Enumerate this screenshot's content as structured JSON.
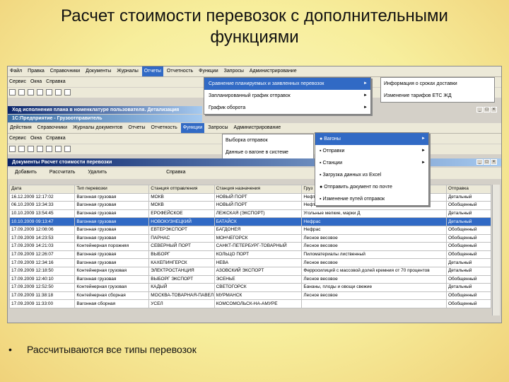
{
  "slide": {
    "title": "Расчет стоимости перевозок с дополнительными функциями",
    "bullet": "Рассчитываются все типы перевозок"
  },
  "app1": {
    "menu": [
      "Файл",
      "Правка",
      "Справочники",
      "Документы",
      "Журналы",
      "Отчеты",
      "Отчетность",
      "Функции",
      "Запросы",
      "Администрирование"
    ],
    "menu2": [
      "Сервис",
      "Окна",
      "Справка"
    ],
    "otchety_dropdown": [
      "Сравнение планируемых и заявленных перевозок",
      "Запланированный график отправок",
      "График оборота"
    ],
    "side_items": [
      "Информация о сроках доставки",
      "Изменение тарифов ЕТС ЖД"
    ]
  },
  "subwindow": {
    "title": "Ход исполнения плана в номенклатуре пользователя. Детализация",
    "platform": "1С:Предприятие - Грузоотправитель"
  },
  "app2": {
    "menu": [
      "Действия",
      "Справочники",
      "Журналы документов",
      "Отчеты",
      "Отчетность",
      "Функции",
      "Запросы",
      "Администрирование"
    ],
    "menu2": [
      "Сервис",
      "Окна",
      "Справка"
    ],
    "otchety_sub": [
      "Выборка отправок",
      "Данные о вагоне в системе"
    ],
    "funkcii_dropdown": [
      {
        "label": "Вагоны",
        "submenu": true
      },
      {
        "label": "Отправки",
        "submenu": true
      },
      {
        "label": "Станции",
        "submenu": true
      },
      {
        "label": "Загрузка данных из Excel",
        "submenu": false
      },
      {
        "label": "Отправить документ по почте",
        "submenu": false
      },
      {
        "label": "Изменение путей отправок",
        "submenu": false
      }
    ]
  },
  "doc_window": {
    "title": "Документы Расчет стоимости перевозки",
    "buttons": [
      "Добавить",
      "Рассчитать",
      "Удалить",
      "Справка"
    ],
    "columns": [
      "Дата",
      "Тип перевозки",
      "Станция отправления",
      "Станция назначения",
      "Груз",
      "Отправка"
    ],
    "rows": [
      [
        "16.12.2009 12:17:02",
        "Вагонная грузовая",
        "МОКВ",
        "НОВЫЙ ПОРТ",
        "Нефтепродукты",
        "Детальный"
      ],
      [
        "06.10.2009 13:34:33",
        "Вагонная грузовая",
        "МОКВ",
        "НОВЫЙ ПОРТ",
        "Нефтепродукты",
        "Обобщенный"
      ],
      [
        "10.10.2009 13:54:45",
        "Вагонная грузовая",
        "ЕРОФЕЙСКОЕ",
        "ЛЕЖСКАЯ (ЭКСПОРТ)",
        "Угольные мелкие, марки Д",
        "Детальный"
      ],
      [
        "10.10.2009 09:13:47",
        "Вагонная грузовая",
        "НОВОКУЗНЕЦКИЙ",
        "БАТАЙСК",
        "Нефрас",
        "Детальный"
      ],
      [
        "17.09.2009 12:08:06",
        "Вагонная грузовая",
        "ЕВТЕРЭКСПОРТ",
        "БАГДОНЕЯ",
        "Нефрас",
        "Обобщенный"
      ],
      [
        "17.09.2009 14:23:53",
        "Вагонная грузовая",
        "ПАРНАС",
        "МОНЧЕГОРСК",
        "Лесное весовое",
        "Обобщенный"
      ],
      [
        "17.09.2009 14:21:03",
        "Контейнерная порожняя",
        "СЕВЕРНЫЙ ПОРТ",
        "САНКТ-ПЕТЕРБУРГ-ТОВАРНЫЙ",
        "Лесное весовое",
        "Обобщенный"
      ],
      [
        "17.09.2009 12:26:07",
        "Вагонная грузовая",
        "ВЫБОРГ",
        "КОЛЬЦО ПОРТ",
        "Пиломатериалы лиственный",
        "Обобщенный"
      ],
      [
        "17.09.2009 12:34:16",
        "Вагонная грузовая",
        "КАХЕПИНГЕРСК",
        "НЕВА",
        "Лесное весовое",
        "Детальный"
      ],
      [
        "17.09.2009 12:18:50",
        "Контейнерная грузовая",
        "ЭЛЕКТРОСТАНЦИЯ",
        "АЗОВСКИЙ ЭКСПОРТ",
        "Ферросилиций с массовой долей кремния от 70 процентов",
        "Детальный"
      ],
      [
        "17.09.2009 12:40:10",
        "Вагонная грузовая",
        "ВЫБОРГ ЭКСПОРТ",
        "ЭСЕНЬЕ",
        "Лесное весовое",
        "Обобщенный"
      ],
      [
        "17.09.2009 12:52:50",
        "Контейнерная грузовая",
        "КАДЫЙ",
        "СВЕТОГОРСК",
        "Бананы, плоды и овощи свежие",
        "Детальный"
      ],
      [
        "17.09.2009 11:38:18",
        "Контейнерная сборная",
        "МОСКВА-ТОВАРНАЯ-ПАВЕЛ",
        "МУРМАНСК",
        "Лесное весовое",
        "Обобщенный"
      ],
      [
        "17.09.2009 11:33:00",
        "Вагонная сборная",
        "УСЕЛ",
        "КОМСОМОЛЬСК-НА-АМУРЕ",
        "",
        "Обобщенный"
      ]
    ],
    "selected_row": 3
  }
}
